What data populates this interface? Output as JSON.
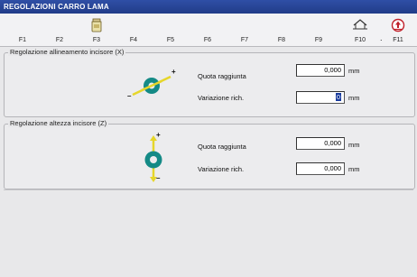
{
  "window": {
    "title": "REGOLAZIONI CARRO LAMA"
  },
  "fkeys": [
    {
      "label": "F1",
      "icon": ""
    },
    {
      "label": "F2",
      "icon": ""
    },
    {
      "label": "F3",
      "icon": "jar-icon"
    },
    {
      "label": "F4",
      "icon": ""
    },
    {
      "label": "F5",
      "icon": ""
    },
    {
      "label": "F6",
      "icon": ""
    },
    {
      "label": "F7",
      "icon": ""
    },
    {
      "label": "F8",
      "icon": ""
    },
    {
      "label": "F9",
      "icon": ""
    },
    {
      "label": "F10",
      "icon": "home-icon"
    },
    {
      "label": "F11",
      "icon": "exit-icon"
    }
  ],
  "fkey_dot": ".",
  "section_alignment": {
    "title": "Regolazione allineamento incisore (X)",
    "plus": "+",
    "minus": "–",
    "reached_label": "Quota raggiunta",
    "reached_value": "0,000",
    "reached_unit": "mm",
    "change_label": "Variazione rich.",
    "change_value": "0",
    "change_unit": "mm"
  },
  "section_height": {
    "title": "Regolazione altezza incisore (Z)",
    "plus": "+",
    "minus": "–",
    "reached_label": "Quota raggiunta",
    "reached_value": "0,000",
    "reached_unit": "mm",
    "change_label": "Variazione rich.",
    "change_value": "0,000",
    "change_unit": "mm"
  },
  "colors": {
    "titlebar": "#2a4699",
    "ring": "#148a86",
    "arrow": "#e6d62a",
    "selection": "#1a3c9e"
  }
}
